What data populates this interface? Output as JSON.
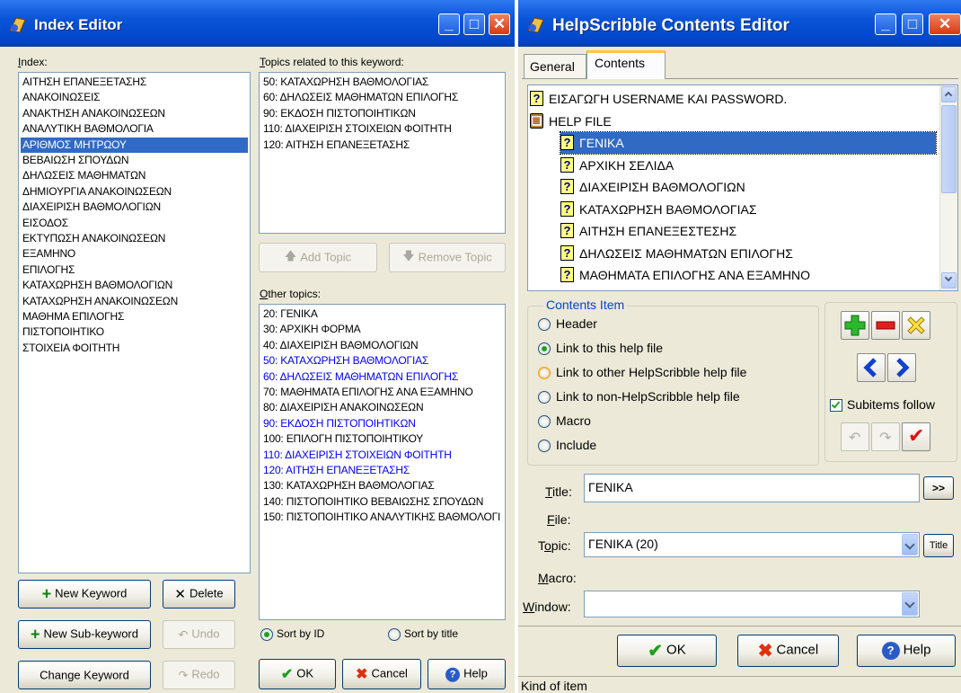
{
  "index_editor": {
    "title": "Index Editor",
    "index_label_u": "I",
    "index_label_rest": "ndex:",
    "keywords": [
      "ΑΙΤΗΣΗ ΕΠΑΝΕΞΕΤΑΣΗΣ",
      "ΑΝΑΚΟΙΝΩΣΕΙΣ",
      "ΑΝΑΚΤΗΣΗ ΑΝΑΚΟΙΝΩΣΕΩΝ",
      "ΑΝΑΛΥΤΙΚΗ ΒΑΘΜΟΛΟΓΙΑ",
      "ΑΡΙΘΜΟΣ ΜΗΤΡΩΟΥ",
      "ΒΕΒΑΙΩΣΗ ΣΠΟΥΔΩΝ",
      "ΔΗΛΩΣΕΙΣ ΜΑΘΗΜΑΤΩΝ",
      "ΔΗΜΙΟΥΡΓΙΑ ΑΝΑΚΟΙΝΩΣΕΩΝ",
      "ΔΙΑΧΕΙΡΙΣΗ ΒΑΘΜΟΛΟΓΙΩΝ",
      "ΕΙΣΟΔΟΣ",
      "ΕΚΤΥΠΩΣΗ ΑΝΑΚΟΙΝΩΣΕΩΝ",
      "ΕΞΑΜΗΝΟ",
      "ΕΠΙΛΟΓΗΣ",
      "ΚΑΤΑΧΩΡΗΣΗ  ΒΑΘΜΟΛΟΓΙΩΝ",
      "ΚΑΤΑΧΩΡΗΣΗ ΑΝΑΚΟΙΝΩΣΕΩΝ",
      "ΜΑΘΗΜΑ ΕΠΙΛΟΓΗΣ",
      "ΠΙΣΤΟΠΟΙΗΤΙΚΟ",
      "ΣΤΟΙΧΕΙΑ ΦΟΙΤΗΤΗ"
    ],
    "selected_keyword_index": 4,
    "related_label_u": "T",
    "related_label_rest": "opics related to this keyword:",
    "related_topics": [
      "50: ΚΑΤΑΧΩΡΗΣΗ ΒΑΘΜΟΛΟΓΙΑΣ",
      "60: ΔΗΛΩΣΕΙΣ ΜΑΘΗΜΑΤΩΝ ΕΠΙΛΟΓΗΣ",
      "90: ΕΚΔΟΣΗ ΠΙΣΤΟΠΟΙΗΤΙΚΩΝ",
      "110: ΔΙΑΧΕΙΡΙΣΗ ΣΤΟΙΧΕΙΩΝ ΦΟΙΤΗΤΗ",
      "120: ΑΙΤΗΣΗ ΕΠΑΝΕΞΕΤΑΣΗΣ"
    ],
    "add_topic": "Add Topic",
    "remove_topic": "Remove Topic",
    "other_label_u": "O",
    "other_label_rest": "ther topics:",
    "other_topics": [
      {
        "text": "20: ΓΕΝΙΚΑ",
        "linked": false
      },
      {
        "text": "30: ΑΡΧΙΚΗ ΦΟΡΜΑ",
        "linked": false
      },
      {
        "text": "40: ΔΙΑΧΕΙΡΙΣΗ ΒΑΘΜΟΛΟΓΙΩΝ",
        "linked": false
      },
      {
        "text": "50: ΚΑΤΑΧΩΡΗΣΗ ΒΑΘΜΟΛΟΓΙΑΣ",
        "linked": true
      },
      {
        "text": "60: ΔΗΛΩΣΕΙΣ ΜΑΘΗΜΑΤΩΝ ΕΠΙΛΟΓΗΣ",
        "linked": true
      },
      {
        "text": "70: ΜΑΘΗΜΑΤΑ ΕΠΙΛΟΓΗΣ ΑΝΑ ΕΞΑΜΗΝΟ",
        "linked": false
      },
      {
        "text": "80: ΔΙΑΧΕΙΡΙΣΗ ΑΝΑΚΟΙΝΩΣΕΩΝ",
        "linked": false
      },
      {
        "text": "90: ΕΚΔΟΣΗ ΠΙΣΤΟΠΟΙΗΤΙΚΩΝ",
        "linked": true
      },
      {
        "text": "100: ΕΠΙΛΟΓΗ ΠΙΣΤΟΠΟΙΗΤΙΚΟΥ",
        "linked": false
      },
      {
        "text": "110: ΔΙΑΧΕΙΡΙΣΗ ΣΤΟΙΧΕΙΩΝ ΦΟΙΤΗΤΗ",
        "linked": true
      },
      {
        "text": "120: ΑΙΤΗΣΗ ΕΠΑΝΕΞΕΤΑΣΗΣ",
        "linked": true
      },
      {
        "text": "130: ΚΑΤΑΧΩΡΗΣΗ ΒΑΘΜΟΛΟΓΙΑΣ",
        "linked": false
      },
      {
        "text": "140: ΠΙΣΤΟΠΟΙΗΤΙΚΟ ΒΕΒΑΙΩΣΗΣ ΣΠΟΥΔΩΝ",
        "linked": false
      },
      {
        "text": "150: ΠΙΣΤΟΠΟΙΗΤΙΚΟ ΑΝΑΛΥΤΙΚΗΣ ΒΑΘΜΟΛΟΓΙ",
        "linked": false
      }
    ],
    "new_keyword": "New Keyword",
    "delete": "Delete",
    "new_sub_keyword": "New Sub-keyword",
    "undo": "Undo",
    "change_keyword": "Change Keyword",
    "redo": "Redo",
    "sort_by_id": "Sort by ID",
    "sort_by_title": "Sort by title",
    "sort_selected": "id",
    "ok": "OK",
    "cancel": "Cancel",
    "help": "Help"
  },
  "contents_editor": {
    "title": "HelpScribble Contents Editor",
    "tabs": [
      "General",
      "Contents"
    ],
    "active_tab": 1,
    "tree": [
      {
        "text": "ΕΙΣΑΓΩΓΗ USERNAME ΚΑΙ PASSWORD.",
        "icon": "topic",
        "level": 0,
        "selected": false
      },
      {
        "text": "HELP FILE",
        "icon": "book",
        "level": 0,
        "selected": false
      },
      {
        "text": "ΓΕΝΙΚΑ",
        "icon": "topic",
        "level": 1,
        "selected": true
      },
      {
        "text": "ΑΡΧΙΚΗ ΣΕΛΙΔΑ",
        "icon": "topic",
        "level": 1,
        "selected": false
      },
      {
        "text": "ΔΙΑΧΕΙΡΙΣΗ ΒΑΘΜΟΛΟΓΙΩΝ",
        "icon": "topic",
        "level": 1,
        "selected": false
      },
      {
        "text": "ΚΑΤΑΧΩΡΗΣΗ ΒΑΘΜΟΛΟΓΙΑΣ",
        "icon": "topic",
        "level": 1,
        "selected": false
      },
      {
        "text": "ΑΙΤΗΣΗ ΕΠΑΝΕΞΕΣΤΕΣΗΣ",
        "icon": "topic",
        "level": 1,
        "selected": false
      },
      {
        "text": "ΔΗΛΩΣΕΙΣ ΜΑΘΗΜΑΤΩΝ ΕΠΙΛΟΓΗΣ",
        "icon": "topic",
        "level": 1,
        "selected": false
      },
      {
        "text": "ΜΑΘΗΜΑΤΑ ΕΠΙΛΟΓΗΣ ΑΝΑ ΕΞΑΜΗΝΟ",
        "icon": "topic",
        "level": 1,
        "selected": false
      }
    ],
    "contents_item_label": "Contents Item",
    "item_types": [
      "Header",
      "Link to this help file",
      "Link to other HelpScribble help file",
      "Link to non-HelpScribble help file",
      "Macro",
      "Include"
    ],
    "selected_item_type": 1,
    "hover_item_type": 2,
    "subitems_follow": "Subitems follow",
    "subitems_checked": true,
    "title_label_u": "T",
    "title_label_rest": "itle:",
    "title_value": "ΓΕΝΙΚΑ",
    "browse_button": ">>",
    "file_label_u": "F",
    "file_label_rest": "ile:",
    "topic_label_pre": "T",
    "topic_label_u": "o",
    "topic_label_rest": "pic:",
    "topic_value": "ΓΕΝΙΚΑ (20)",
    "topic_title_button": "Title",
    "macro_label_u": "M",
    "macro_label_rest": "acro:",
    "window_label_u": "W",
    "window_label_rest": "indow:",
    "window_value": "",
    "ok": "OK",
    "cancel": "Cancel",
    "help": "Help",
    "status_text": "Kind of item"
  },
  "colors": {
    "titlebar": "#0a54d8",
    "selection": "#316ac5",
    "link_topic": "#0000ff",
    "dialog_bg": "#ece9d8"
  }
}
